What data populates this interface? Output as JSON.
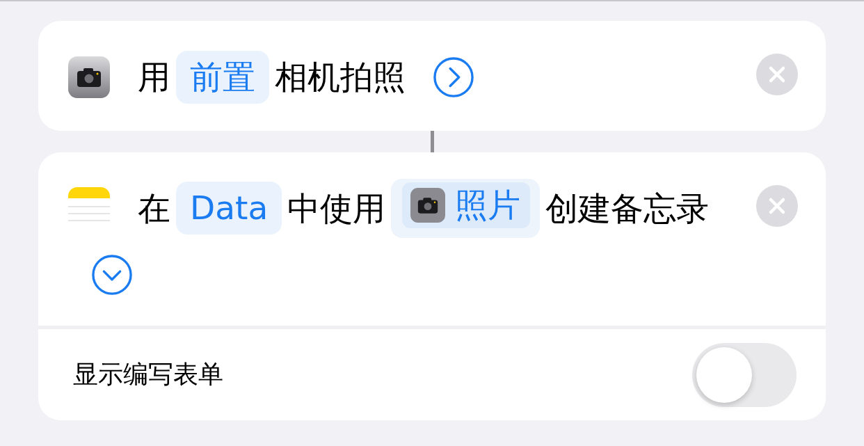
{
  "actions": [
    {
      "kind": "camera",
      "expanded": false,
      "parts": [
        {
          "kind": "text",
          "text": "用"
        },
        {
          "kind": "token",
          "text": "前置"
        },
        {
          "kind": "text",
          "text": "相机拍照"
        }
      ]
    },
    {
      "kind": "notes",
      "expanded": true,
      "parts": [
        {
          "kind": "text",
          "text": "在"
        },
        {
          "kind": "token",
          "text": "Data"
        },
        {
          "kind": "text",
          "text": "中使用"
        },
        {
          "kind": "camera_token",
          "text": "照片"
        },
        {
          "kind": "text",
          "text": "创建备忘录"
        }
      ],
      "option": {
        "label": "显示编写表单",
        "on": false
      }
    }
  ]
}
